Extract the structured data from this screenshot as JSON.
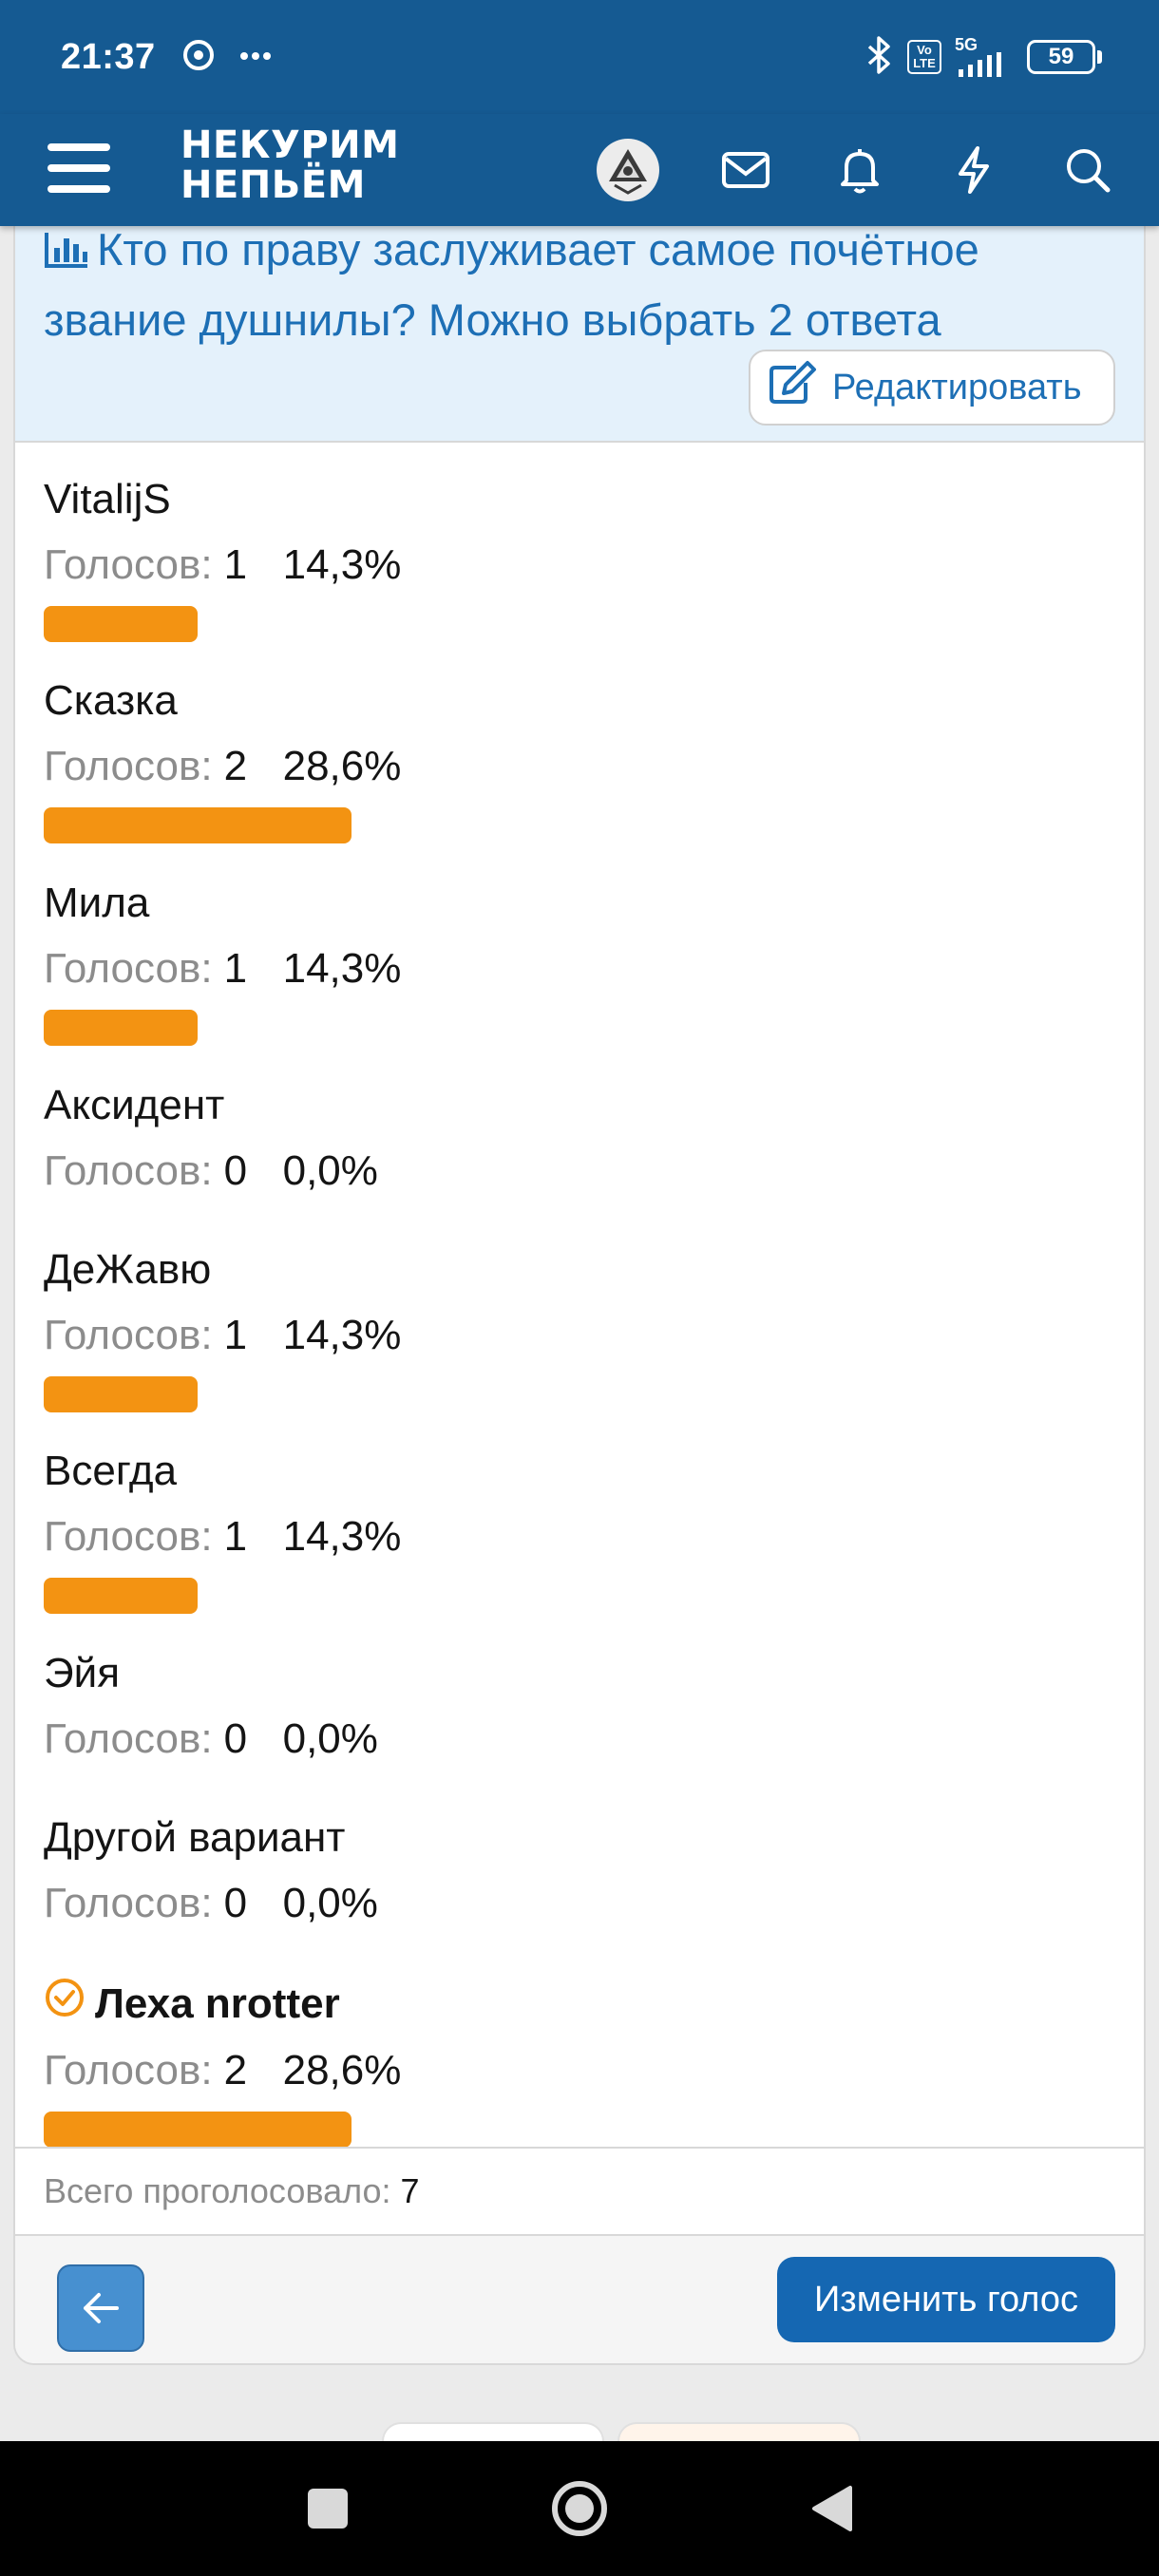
{
  "status_bar": {
    "time": "21:37",
    "network": "5G",
    "volte_label": "Vo LTE",
    "battery": "59",
    "icons": [
      "chrome-icon",
      "more-dots-icon",
      "bluetooth-icon",
      "volte-icon",
      "signal-icon",
      "battery-icon"
    ]
  },
  "header": {
    "logo_line1": "НЕКУРИМ",
    "logo_line2": "НЕПЬЁМ",
    "icons": [
      "menu-icon",
      "avatar",
      "mail-icon",
      "bell-icon",
      "lightning-icon",
      "search-icon"
    ]
  },
  "poll": {
    "title": "Кто по праву заслуживает самое почётное звание душнилы? Можно выбрать 2 ответа",
    "edit_label": "Редактировать",
    "votes_label": "Голосов:",
    "options": [
      {
        "label": "VitalijS",
        "votes": "1",
        "percent": "14,3%",
        "fraction": 0.143,
        "voted_by_me": false
      },
      {
        "label": "Сказка",
        "votes": "2",
        "percent": "28,6%",
        "fraction": 0.286,
        "voted_by_me": false
      },
      {
        "label": "Мила",
        "votes": "1",
        "percent": "14,3%",
        "fraction": 0.143,
        "voted_by_me": false
      },
      {
        "label": "Аксидент",
        "votes": "0",
        "percent": "0,0%",
        "fraction": 0.0,
        "voted_by_me": false
      },
      {
        "label": "ДеЖавю",
        "votes": "1",
        "percent": "14,3%",
        "fraction": 0.143,
        "voted_by_me": false
      },
      {
        "label": "Всегда",
        "votes": "1",
        "percent": "14,3%",
        "fraction": 0.143,
        "voted_by_me": false
      },
      {
        "label": "Эйя",
        "votes": "0",
        "percent": "0,0%",
        "fraction": 0.0,
        "voted_by_me": false
      },
      {
        "label": "Другой вариант",
        "votes": "0",
        "percent": "0,0%",
        "fraction": 0.0,
        "voted_by_me": false
      },
      {
        "label": "Леха nrotter",
        "votes": "2",
        "percent": "28,6%",
        "fraction": 0.286,
        "voted_by_me": true
      }
    ],
    "total_label": "Всего проголосовало:",
    "total_value": "7",
    "change_vote_label": "Изменить голос"
  },
  "colors": {
    "header_bg": "#155a92",
    "accent": "#1d6fb5",
    "bar": "#f39312",
    "poll_header_bg": "#e4f1fb"
  }
}
